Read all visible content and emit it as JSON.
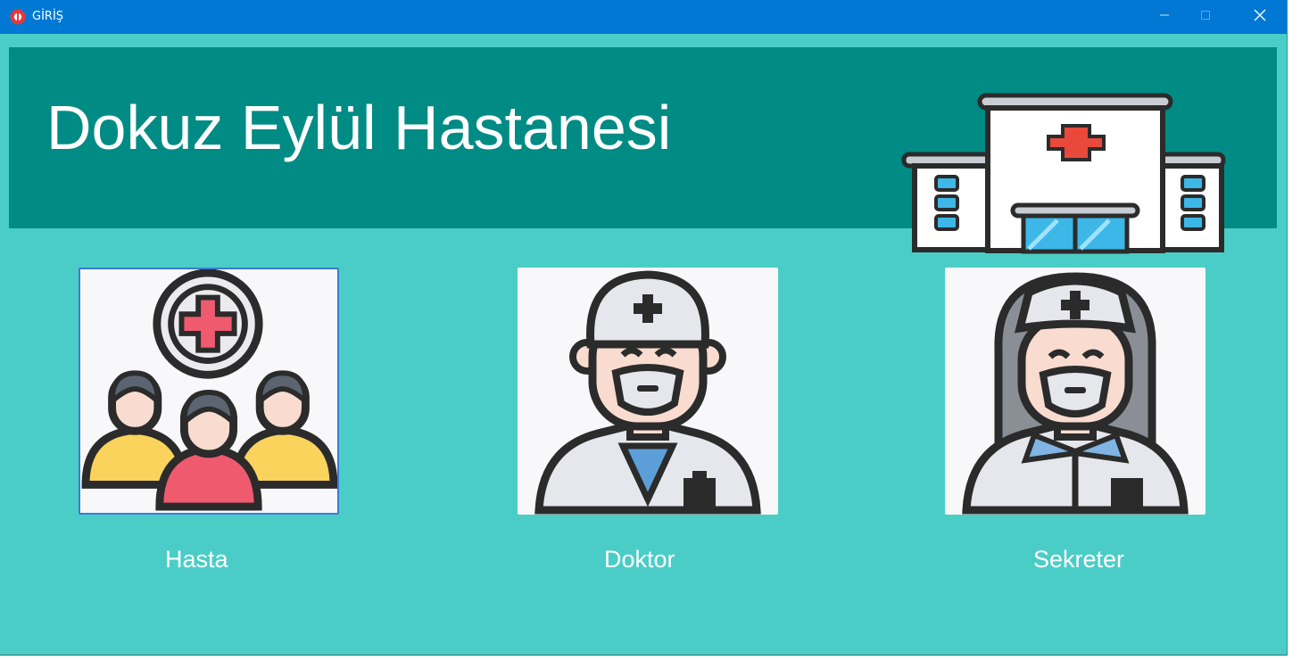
{
  "window": {
    "title": "GİRİŞ",
    "title_bar_color": "#0078d4",
    "background_color": "#4bcdc7",
    "controls": [
      "minimize-icon",
      "maximize-icon",
      "close-icon"
    ]
  },
  "banner": {
    "title": "Dokuz Eylül Hastanesi",
    "background_color": "#008b85",
    "icon": "hospital-building-icon"
  },
  "roles": [
    {
      "label": "Hasta",
      "icon": "patients-group-icon",
      "selected": true
    },
    {
      "label": "Doktor",
      "icon": "doctor-icon",
      "selected": false
    },
    {
      "label": "Sekreter",
      "icon": "secretary-nurse-icon",
      "selected": false
    }
  ]
}
